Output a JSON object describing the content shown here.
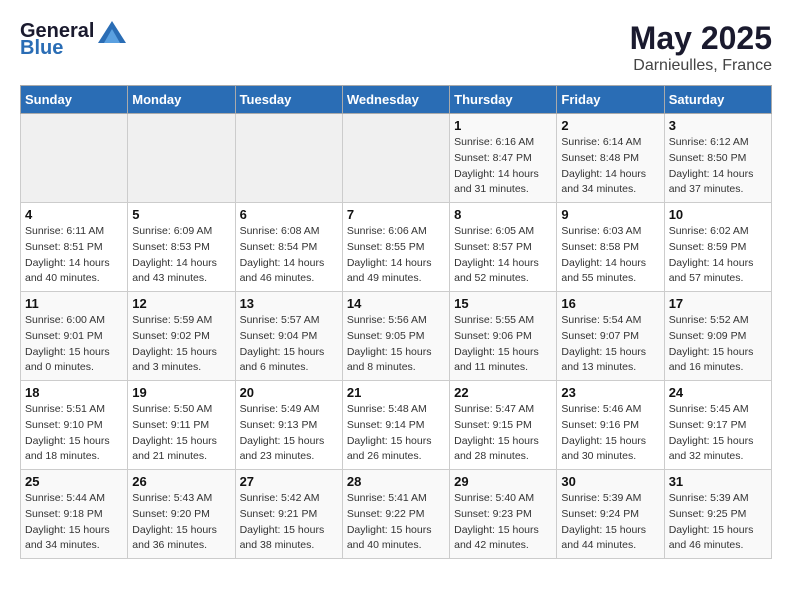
{
  "header": {
    "logo_general": "General",
    "logo_blue": "Blue",
    "title": "May 2025",
    "subtitle": "Darnieulles, France"
  },
  "weekdays": [
    "Sunday",
    "Monday",
    "Tuesday",
    "Wednesday",
    "Thursday",
    "Friday",
    "Saturday"
  ],
  "weeks": [
    [
      {
        "day": "",
        "detail": ""
      },
      {
        "day": "",
        "detail": ""
      },
      {
        "day": "",
        "detail": ""
      },
      {
        "day": "",
        "detail": ""
      },
      {
        "day": "1",
        "detail": "Sunrise: 6:16 AM\nSunset: 8:47 PM\nDaylight: 14 hours\nand 31 minutes."
      },
      {
        "day": "2",
        "detail": "Sunrise: 6:14 AM\nSunset: 8:48 PM\nDaylight: 14 hours\nand 34 minutes."
      },
      {
        "day": "3",
        "detail": "Sunrise: 6:12 AM\nSunset: 8:50 PM\nDaylight: 14 hours\nand 37 minutes."
      }
    ],
    [
      {
        "day": "4",
        "detail": "Sunrise: 6:11 AM\nSunset: 8:51 PM\nDaylight: 14 hours\nand 40 minutes."
      },
      {
        "day": "5",
        "detail": "Sunrise: 6:09 AM\nSunset: 8:53 PM\nDaylight: 14 hours\nand 43 minutes."
      },
      {
        "day": "6",
        "detail": "Sunrise: 6:08 AM\nSunset: 8:54 PM\nDaylight: 14 hours\nand 46 minutes."
      },
      {
        "day": "7",
        "detail": "Sunrise: 6:06 AM\nSunset: 8:55 PM\nDaylight: 14 hours\nand 49 minutes."
      },
      {
        "day": "8",
        "detail": "Sunrise: 6:05 AM\nSunset: 8:57 PM\nDaylight: 14 hours\nand 52 minutes."
      },
      {
        "day": "9",
        "detail": "Sunrise: 6:03 AM\nSunset: 8:58 PM\nDaylight: 14 hours\nand 55 minutes."
      },
      {
        "day": "10",
        "detail": "Sunrise: 6:02 AM\nSunset: 8:59 PM\nDaylight: 14 hours\nand 57 minutes."
      }
    ],
    [
      {
        "day": "11",
        "detail": "Sunrise: 6:00 AM\nSunset: 9:01 PM\nDaylight: 15 hours\nand 0 minutes."
      },
      {
        "day": "12",
        "detail": "Sunrise: 5:59 AM\nSunset: 9:02 PM\nDaylight: 15 hours\nand 3 minutes."
      },
      {
        "day": "13",
        "detail": "Sunrise: 5:57 AM\nSunset: 9:04 PM\nDaylight: 15 hours\nand 6 minutes."
      },
      {
        "day": "14",
        "detail": "Sunrise: 5:56 AM\nSunset: 9:05 PM\nDaylight: 15 hours\nand 8 minutes."
      },
      {
        "day": "15",
        "detail": "Sunrise: 5:55 AM\nSunset: 9:06 PM\nDaylight: 15 hours\nand 11 minutes."
      },
      {
        "day": "16",
        "detail": "Sunrise: 5:54 AM\nSunset: 9:07 PM\nDaylight: 15 hours\nand 13 minutes."
      },
      {
        "day": "17",
        "detail": "Sunrise: 5:52 AM\nSunset: 9:09 PM\nDaylight: 15 hours\nand 16 minutes."
      }
    ],
    [
      {
        "day": "18",
        "detail": "Sunrise: 5:51 AM\nSunset: 9:10 PM\nDaylight: 15 hours\nand 18 minutes."
      },
      {
        "day": "19",
        "detail": "Sunrise: 5:50 AM\nSunset: 9:11 PM\nDaylight: 15 hours\nand 21 minutes."
      },
      {
        "day": "20",
        "detail": "Sunrise: 5:49 AM\nSunset: 9:13 PM\nDaylight: 15 hours\nand 23 minutes."
      },
      {
        "day": "21",
        "detail": "Sunrise: 5:48 AM\nSunset: 9:14 PM\nDaylight: 15 hours\nand 26 minutes."
      },
      {
        "day": "22",
        "detail": "Sunrise: 5:47 AM\nSunset: 9:15 PM\nDaylight: 15 hours\nand 28 minutes."
      },
      {
        "day": "23",
        "detail": "Sunrise: 5:46 AM\nSunset: 9:16 PM\nDaylight: 15 hours\nand 30 minutes."
      },
      {
        "day": "24",
        "detail": "Sunrise: 5:45 AM\nSunset: 9:17 PM\nDaylight: 15 hours\nand 32 minutes."
      }
    ],
    [
      {
        "day": "25",
        "detail": "Sunrise: 5:44 AM\nSunset: 9:18 PM\nDaylight: 15 hours\nand 34 minutes."
      },
      {
        "day": "26",
        "detail": "Sunrise: 5:43 AM\nSunset: 9:20 PM\nDaylight: 15 hours\nand 36 minutes."
      },
      {
        "day": "27",
        "detail": "Sunrise: 5:42 AM\nSunset: 9:21 PM\nDaylight: 15 hours\nand 38 minutes."
      },
      {
        "day": "28",
        "detail": "Sunrise: 5:41 AM\nSunset: 9:22 PM\nDaylight: 15 hours\nand 40 minutes."
      },
      {
        "day": "29",
        "detail": "Sunrise: 5:40 AM\nSunset: 9:23 PM\nDaylight: 15 hours\nand 42 minutes."
      },
      {
        "day": "30",
        "detail": "Sunrise: 5:39 AM\nSunset: 9:24 PM\nDaylight: 15 hours\nand 44 minutes."
      },
      {
        "day": "31",
        "detail": "Sunrise: 5:39 AM\nSunset: 9:25 PM\nDaylight: 15 hours\nand 46 minutes."
      }
    ]
  ]
}
